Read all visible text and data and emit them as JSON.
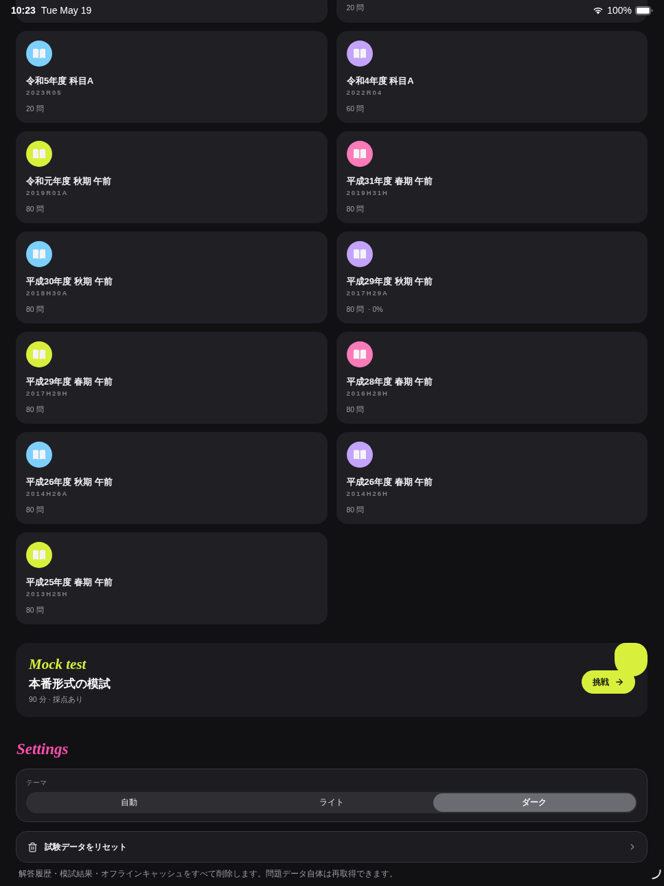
{
  "status_bar": {
    "time": "10:23",
    "date": "Tue May 19",
    "battery": "100%"
  },
  "cut_off_cards": [
    {
      "count": "20 問"
    }
  ],
  "exam_cards": [
    {
      "title": "令和5年度 科目A",
      "code": "2023R05",
      "count": "20 問",
      "color": "#7dd0fd"
    },
    {
      "title": "令和4年度 科目A",
      "code": "2022R04",
      "count": "60 問",
      "color": "#c3a3fb"
    },
    {
      "title": "令和元年度 秋期 午前",
      "code": "2019R01A",
      "count": "80 問",
      "color": "#d8f03c"
    },
    {
      "title": "平成31年度 春期 午前",
      "code": "2019H31H",
      "count": "80 問",
      "color": "#fb7bb8"
    },
    {
      "title": "平成30年度 秋期 午前",
      "code": "2018H30A",
      "count": "80 問",
      "color": "#7dd0fd"
    },
    {
      "title": "平成29年度 秋期 午前",
      "code": "2017H29A",
      "count": "80 問",
      "progress": "· 0%",
      "color": "#c3a3fb"
    },
    {
      "title": "平成29年度 春期 午前",
      "code": "2017H29H",
      "count": "80 問",
      "color": "#d8f03c"
    },
    {
      "title": "平成28年度 春期 午前",
      "code": "2016H28H",
      "count": "80 問",
      "color": "#fb7bb8"
    },
    {
      "title": "平成26年度 秋期 午前",
      "code": "2014H26A",
      "count": "80 問",
      "color": "#7dd0fd"
    },
    {
      "title": "平成26年度 春期 午前",
      "code": "2014H26H",
      "count": "80 問",
      "color": "#c3a3fb"
    },
    {
      "title": "平成25年度 春期 午前",
      "code": "2013H25H",
      "count": "80 問",
      "color": "#d8f03c"
    }
  ],
  "mock_test": {
    "eyebrow": "Mock test",
    "title": "本番形式の模試",
    "meta": "90 分 · 採点あり",
    "button": "挑戦"
  },
  "settings": {
    "heading": "Settings",
    "theme": {
      "label": "テーマ",
      "options": [
        {
          "label": "自動",
          "selected": false
        },
        {
          "label": "ライト",
          "selected": false
        },
        {
          "label": "ダーク",
          "selected": true
        }
      ]
    },
    "reset": {
      "label": "試験データをリセット"
    },
    "note": "解答履歴・模試結果・オフラインキャッシュをすべて削除します。問題データ自体は再取得できます。"
  }
}
